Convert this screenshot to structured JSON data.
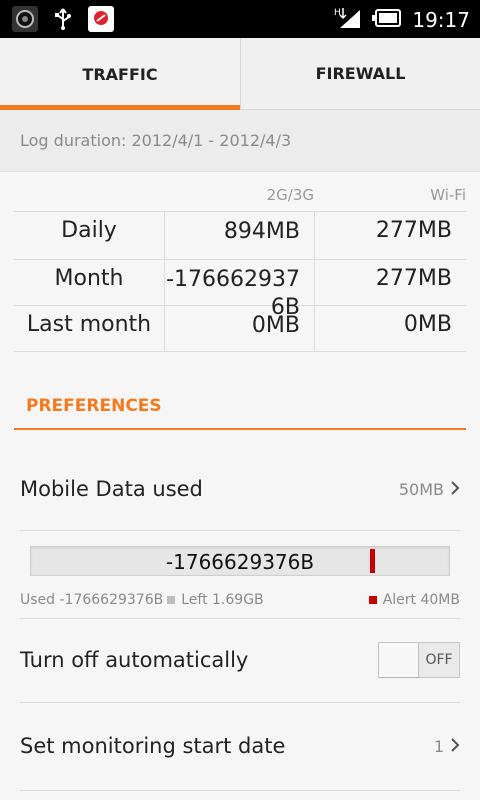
{
  "status_bar": {
    "time": "19:17",
    "left_icons": [
      "app-icon",
      "usb-icon",
      "antivirus-icon"
    ],
    "right_icons": [
      "hsdpa-signal-icon",
      "battery-icon"
    ]
  },
  "tabs": [
    {
      "label": "TRAFFIC",
      "active": true
    },
    {
      "label": "FIREWALL",
      "active": false
    }
  ],
  "log_duration": "Log duration: 2012/4/1 - 2012/4/3",
  "traffic_table": {
    "headers": [
      "",
      "2G/3G",
      "Wi-Fi"
    ],
    "rows": [
      {
        "label": "Daily",
        "mobile": "894MB",
        "wifi": "277MB"
      },
      {
        "label": "Month",
        "mobile": "-1766629376B",
        "wifi": "277MB"
      },
      {
        "label": "Last month",
        "mobile": "0MB",
        "wifi": "0MB"
      }
    ]
  },
  "preferences": {
    "title": "PREFERENCES",
    "mobile_data": {
      "label": "Mobile Data used",
      "value": "50MB"
    },
    "usage_bar": {
      "text": "-1766629376B",
      "alert_level": 0.81,
      "marker_color": "#c40000"
    },
    "legend": {
      "used": "Used -1766629376B",
      "left": "Left 1.69GB",
      "alert": "Alert 40MB",
      "used_color": "#bdbdbd",
      "alert_color": "#c40000"
    },
    "turn_off": {
      "label": "Turn off automatically",
      "toggle": "OFF"
    },
    "start_date": {
      "label": "Set monitoring start date",
      "value": "1"
    }
  },
  "colors": {
    "accent": "#f37a1f",
    "status_bar": "#000000"
  }
}
